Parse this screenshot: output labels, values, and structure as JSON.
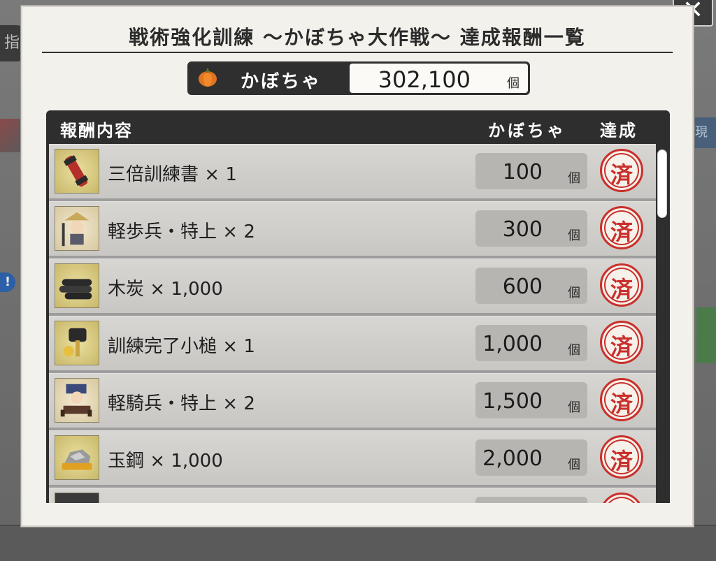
{
  "dialog": {
    "title": "戦術強化訓練 〜かぼちゃ大作戦〜 達成報酬一覧",
    "close_label": "✕"
  },
  "counter": {
    "icon": "pumpkin-icon",
    "label": "かぼちゃ",
    "value": "302,100",
    "unit": "個"
  },
  "table": {
    "headers": {
      "content": "報酬内容",
      "pumpkin": "かぼちゃ",
      "done": "達成"
    },
    "rows": [
      {
        "name": "三倍訓練書 × 1",
        "cost": "100",
        "unit": "個",
        "stamp": "済",
        "icon": "scroll-icon"
      },
      {
        "name": "軽歩兵・特上 × 2",
        "cost": "300",
        "unit": "個",
        "stamp": "済",
        "icon": "foot-soldier-icon"
      },
      {
        "name": "木炭 × 1,000",
        "cost": "600",
        "unit": "個",
        "stamp": "済",
        "icon": "charcoal-icon"
      },
      {
        "name": "訓練完了小槌 × 1",
        "cost": "1,000",
        "unit": "個",
        "stamp": "済",
        "icon": "mallet-icon"
      },
      {
        "name": "軽騎兵・特上 × 2",
        "cost": "1,500",
        "unit": "個",
        "stamp": "済",
        "icon": "cavalry-icon"
      },
      {
        "name": "玉鋼 × 1,000",
        "cost": "2,000",
        "unit": "個",
        "stamp": "済",
        "icon": "steel-icon"
      }
    ]
  },
  "background": {
    "tab_label": "指",
    "right_label": "現"
  },
  "colors": {
    "accent_red": "#c9302c",
    "header_dark": "#2e2e2e",
    "dialog_bg": "#f3f1ec"
  }
}
